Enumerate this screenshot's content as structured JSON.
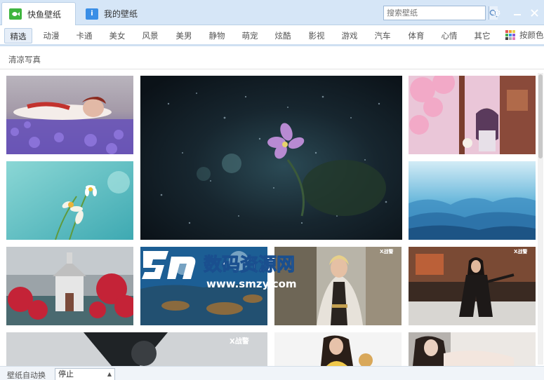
{
  "tabs": [
    {
      "label": "快鱼壁纸",
      "icon": "fish-logo-icon",
      "active": true
    },
    {
      "label": "我的壁纸",
      "icon": "info-book-icon",
      "active": false
    }
  ],
  "search": {
    "placeholder": "搜索壁纸"
  },
  "window": {
    "settings_icon": "gear-icon",
    "minimize_icon": "minimize-icon",
    "close_icon": "close-icon"
  },
  "categories": [
    "精选",
    "动漫",
    "卡通",
    "美女",
    "风景",
    "美男",
    "静物",
    "萌宠",
    "炫酷",
    "影视",
    "游戏",
    "汽车",
    "体育",
    "心情",
    "其它"
  ],
  "sort": {
    "label": "按颜色"
  },
  "subtitle": "清凉写真",
  "watermark": {
    "title": "数码资源网",
    "url": "www.smzy.com"
  },
  "statusbar": {
    "label": "壁纸自动换",
    "select_value": "停止"
  },
  "colors": {
    "accent": "#3a8ee6",
    "titlebar": "#d6e6f7",
    "logo_green": "#3fb53f"
  }
}
